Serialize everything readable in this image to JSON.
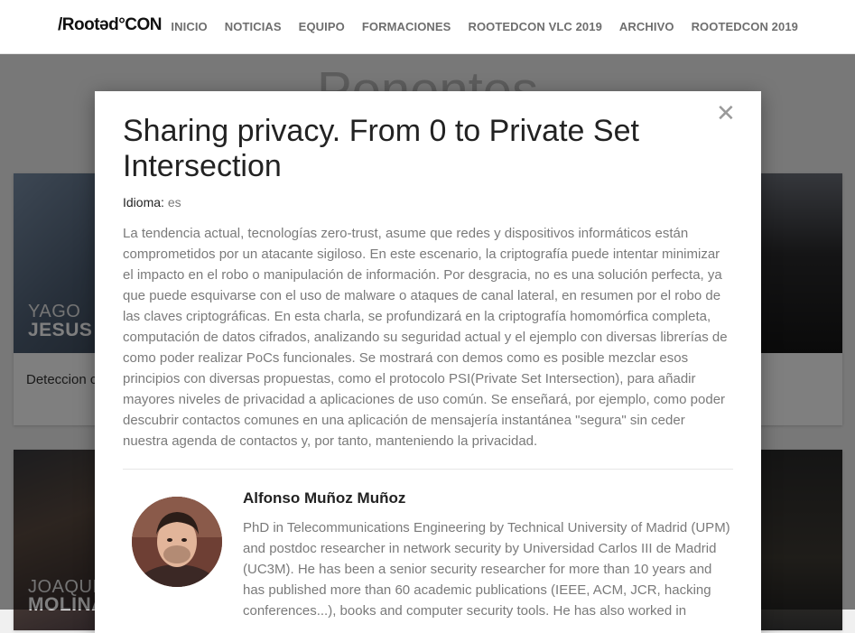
{
  "header": {
    "logo_text": "/Rootəd°CON",
    "nav": [
      "INICIO",
      "NOTICIAS",
      "EQUIPO",
      "FORMACIONES",
      "ROOTEDCON VLC 2019",
      "ARCHIVO",
      "ROOTEDCON 2019"
    ]
  },
  "page": {
    "title": "Ponentes",
    "cards": [
      {
        "first_name": "YAGO",
        "last_name": "JESUS",
        "talk": "Deteccion c"
      },
      {
        "first_name": "JOAQUIN",
        "last_name": "MOLINA"
      }
    ]
  },
  "modal": {
    "title": "Sharing privacy. From 0 to Private Set Intersection",
    "language_label": "Idioma:",
    "language_value": "es",
    "description": "La tendencia actual, tecnologías zero-trust, asume que redes y dispositivos informáticos están comprometidos por un atacante sigiloso. En este escenario, la criptografía puede intentar minimizar el impacto en el robo o manipulación de información. Por desgracia, no es una solución perfecta, ya que puede esquivarse con el uso de malware o ataques de canal lateral, en resumen por el robo de las claves criptográficas. En esta charla, se profundizará en la criptografía homomórfica completa, computación de datos cifrados, analizando su seguridad actual y el ejemplo con diversas librerías de como poder realizar PoCs funcionales. Se mostrará con demos como es posible mezclar esos principios con diversas propuestas, como el protocolo PSI(Private Set Intersection), para añadir mayores niveles de privacidad a aplicaciones de uso común. Se enseñará, por ejemplo, como poder descubrir contactos comunes en una aplicación de mensajería instantánea \"segura\" sin ceder nuestra agenda de contactos y, por tanto, manteniendo la privacidad.",
    "close_icon": "close-icon",
    "speaker": {
      "name": "Alfonso Muñoz Muñoz",
      "bio": "PhD in Telecommunications Engineering by Technical University of Madrid (UPM) and postdoc researcher in network security by Universidad Carlos III de Madrid (UC3M). He has been a senior security researcher for more than 10 years and has published more than 60 academic publications (IEEE, ACM, JCR, hacking conferences...), books and computer security tools. He has also worked in"
    }
  }
}
